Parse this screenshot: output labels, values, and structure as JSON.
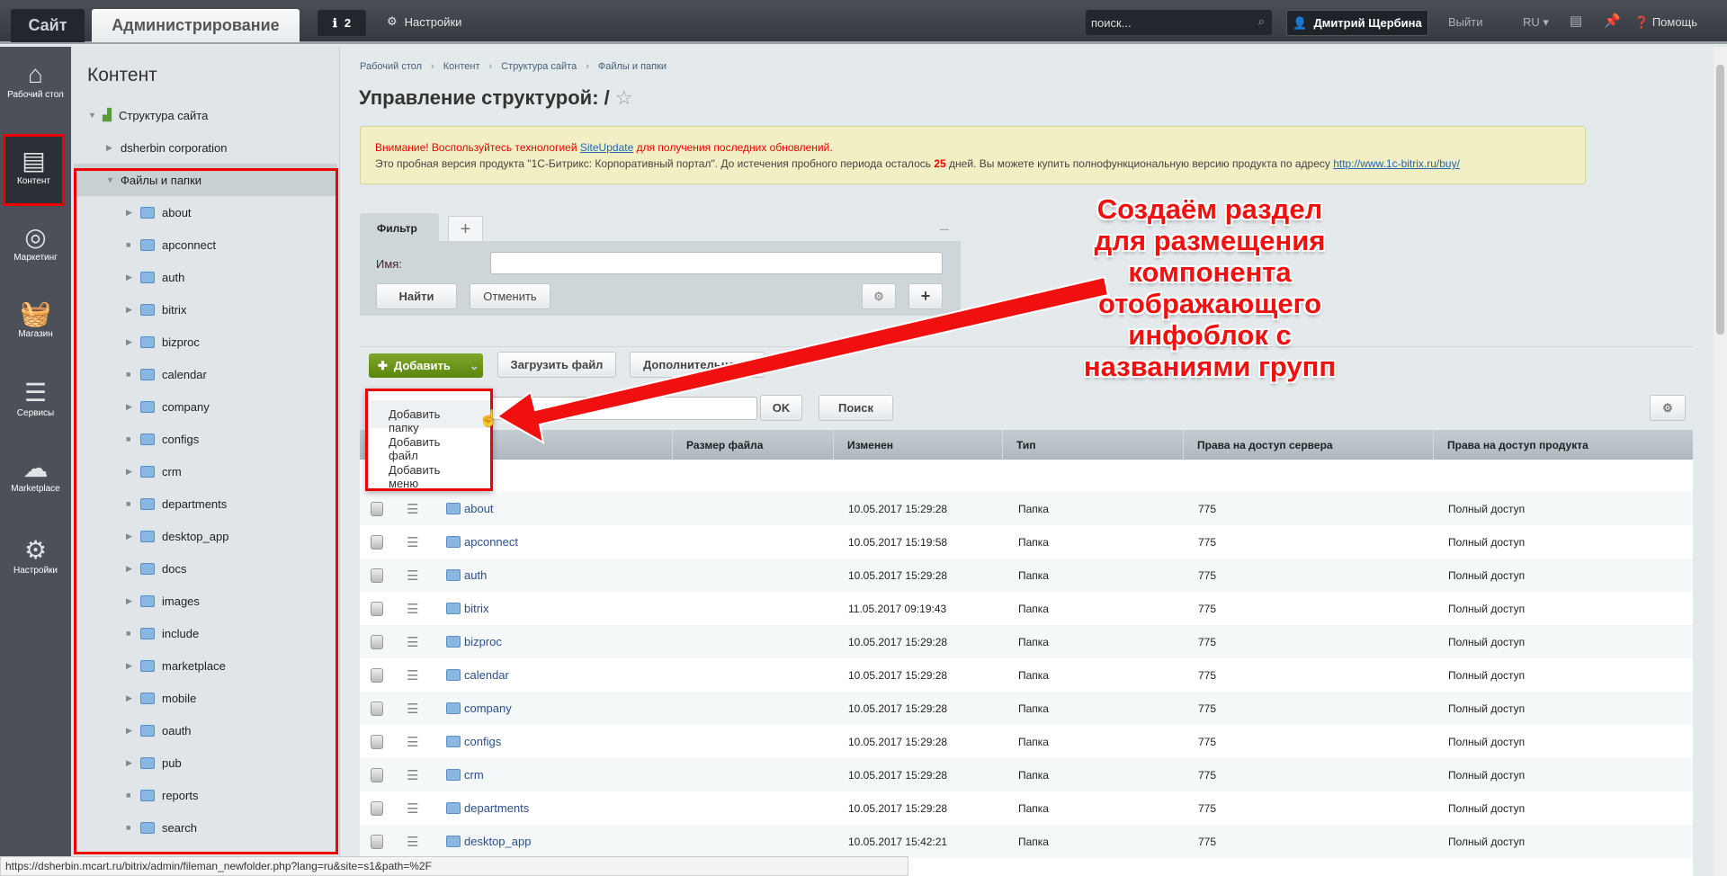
{
  "topbar": {
    "site_tab": "Сайт",
    "admin_tab": "Администрирование",
    "notifications_count": "2",
    "settings": "Настройки",
    "search_placeholder": "поиск...",
    "user": "Дмитрий Щербина",
    "logout": "Выйти",
    "lang": "RU",
    "help": "Помощь"
  },
  "sidebar": {
    "items": [
      {
        "label": "Рабочий стол",
        "icon": "home-icon"
      },
      {
        "label": "Контент",
        "icon": "document-icon"
      },
      {
        "label": "Маркетинг",
        "icon": "target-icon"
      },
      {
        "label": "Магазин",
        "icon": "basket-icon"
      },
      {
        "label": "Сервисы",
        "icon": "layers-icon"
      },
      {
        "label": "Marketplace",
        "icon": "cloud-icon"
      },
      {
        "label": "Настройки",
        "icon": "gear-icon"
      }
    ]
  },
  "panel": {
    "title": "Контент",
    "root": "Структура сайта",
    "corp": "dsherbin corporation",
    "files": "Файлы и папки",
    "folders": [
      {
        "n": "about",
        "c": true
      },
      {
        "n": "apconnect",
        "c": false
      },
      {
        "n": "auth",
        "c": true
      },
      {
        "n": "bitrix",
        "c": true
      },
      {
        "n": "bizproc",
        "c": true
      },
      {
        "n": "calendar",
        "c": false
      },
      {
        "n": "company",
        "c": true
      },
      {
        "n": "configs",
        "c": false
      },
      {
        "n": "crm",
        "c": true
      },
      {
        "n": "departments",
        "c": false
      },
      {
        "n": "desktop_app",
        "c": true
      },
      {
        "n": "docs",
        "c": true
      },
      {
        "n": "images",
        "c": true
      },
      {
        "n": "include",
        "c": false
      },
      {
        "n": "marketplace",
        "c": true
      },
      {
        "n": "mobile",
        "c": true
      },
      {
        "n": "oauth",
        "c": true
      },
      {
        "n": "pub",
        "c": true
      },
      {
        "n": "reports",
        "c": false
      },
      {
        "n": "search",
        "c": false
      }
    ]
  },
  "breadcrumb": [
    "Рабочий стол",
    "Контент",
    "Структура сайта",
    "Файлы и папки"
  ],
  "title": "Управление структурой: /",
  "notice": {
    "l1a": "Внимание! Воспользуйтесь технологией ",
    "l1link": "SiteUpdate",
    "l1b": " для получения последних обновлений.",
    "l2a": "Это пробная версия продукта \"1С-Битрикс: Корпоративный портал\". До истечения пробного периода осталось ",
    "days": "25",
    "l2b": " дней. Вы можете купить полнофункциональную версию продукта по адресу ",
    "l2link": "http://www.1c-bitrix.ru/buy/"
  },
  "filter": {
    "tab": "Фильтр",
    "name_label": "Имя:",
    "name_value": "",
    "find": "Найти",
    "cancel": "Отменить"
  },
  "toolbar": {
    "add": "Добавить",
    "upload": "Загрузить файл",
    "more": "Дополнительно",
    "ok": "OK",
    "search": "Поиск"
  },
  "dropdown": [
    "Добавить папку",
    "Добавить файл",
    "Добавить меню"
  ],
  "columns": [
    "",
    "Размер файла",
    "Изменен",
    "Тип",
    "Права на доступ сервера",
    "Права на доступ продукта"
  ],
  "rows": [
    [
      "about",
      "10.05.2017 15:29:28"
    ],
    [
      "apconnect",
      "10.05.2017 15:19:58"
    ],
    [
      "auth",
      "10.05.2017 15:29:28"
    ],
    [
      "bitrix",
      "11.05.2017 09:19:43"
    ],
    [
      "bizproc",
      "10.05.2017 15:29:28"
    ],
    [
      "calendar",
      "10.05.2017 15:29:28"
    ],
    [
      "company",
      "10.05.2017 15:29:28"
    ],
    [
      "configs",
      "10.05.2017 15:29:28"
    ],
    [
      "crm",
      "10.05.2017 15:29:28"
    ],
    [
      "departments",
      "10.05.2017 15:29:28"
    ],
    [
      "desktop_app",
      "10.05.2017 15:42:21"
    ]
  ],
  "row_type": "Папка",
  "row_perm": "775",
  "row_access": "Полный доступ",
  "annotation": "Создаём раздел для размещения компонента отображающего инфоблок с названиями групп",
  "status_url": "https://dsherbin.mcart.ru/bitrix/admin/fileman_newfolder.php?lang=ru&site=s1&path=%2F",
  "colors": {
    "accent_green": "#6a9419",
    "annotation_red": "#f01010",
    "topbar": "#3d4147"
  }
}
